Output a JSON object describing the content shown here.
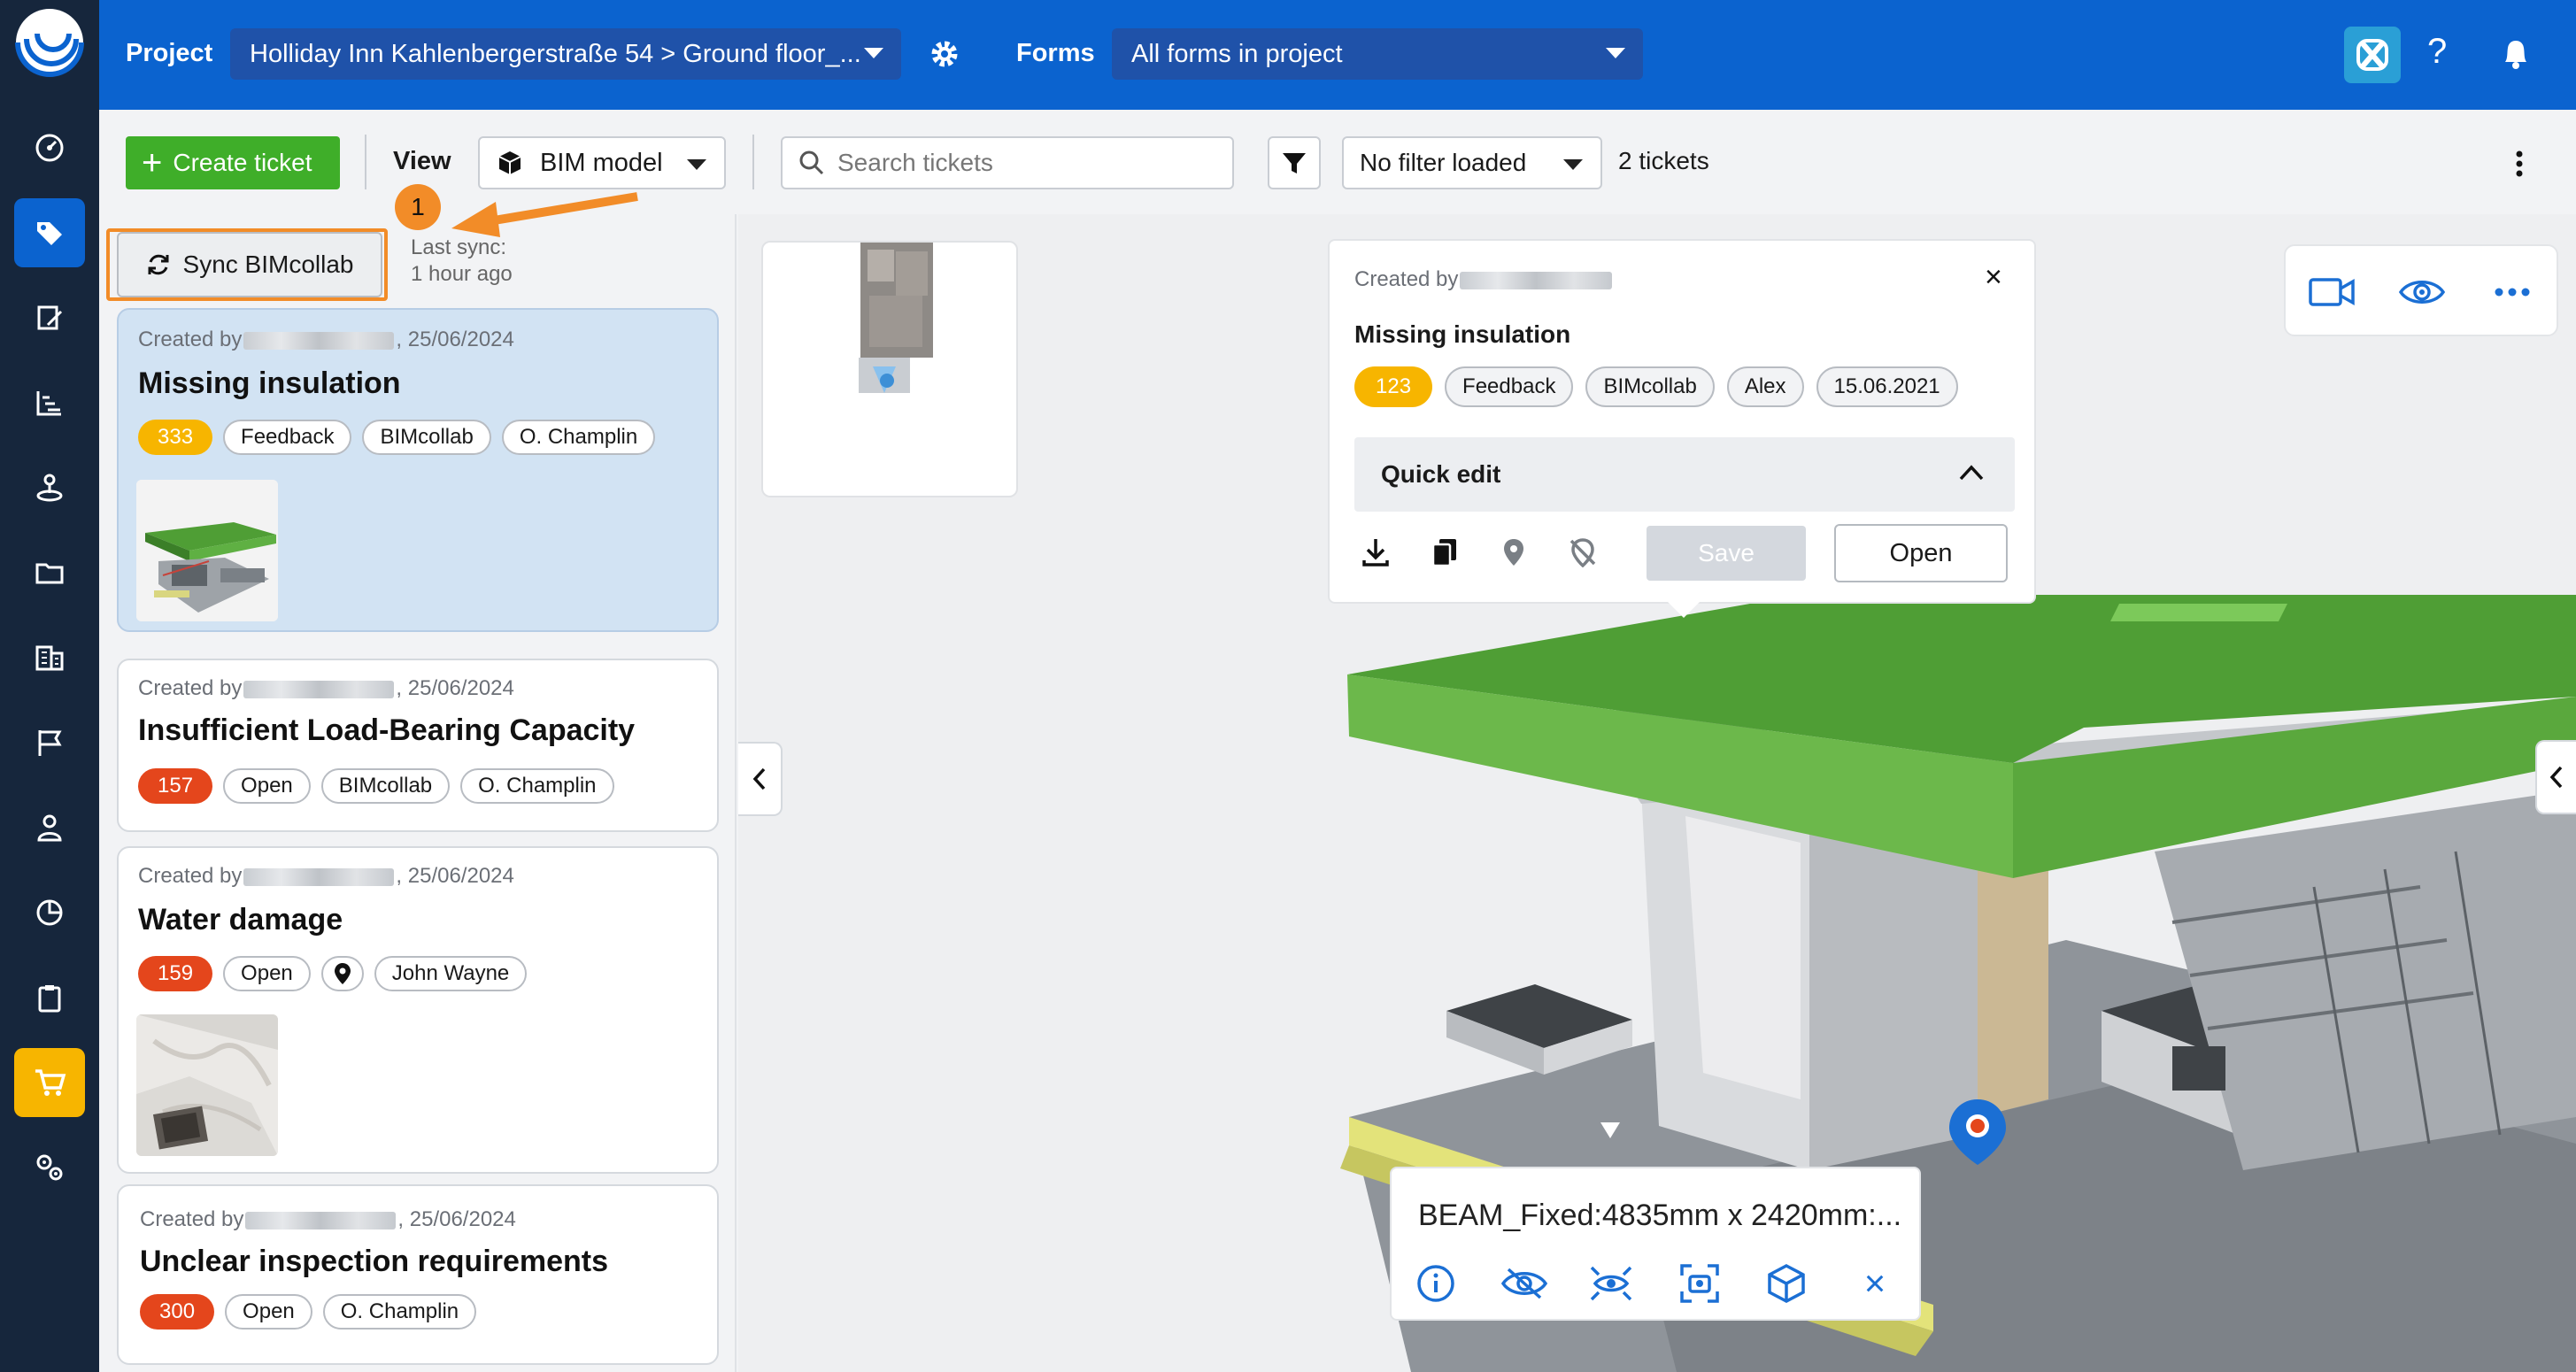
{
  "topbar": {
    "project_label": "Project",
    "project_value": "Holliday Inn Kahlenbergerstraße 54 > Ground floor_...",
    "forms_label": "Forms",
    "forms_value": "All forms in project"
  },
  "toolbar": {
    "create_ticket": "Create ticket",
    "view_label": "View",
    "view_value": "BIM model",
    "search_placeholder": "Search tickets",
    "filter_value": "No filter loaded",
    "ticket_count": "2 tickets"
  },
  "sync": {
    "button": "Sync BIMcollab",
    "last_sync_label": "Last sync:",
    "last_sync_value": "1 hour ago",
    "step_badge": "1"
  },
  "tickets": [
    {
      "created_prefix": "Created by",
      "date": ", 25/06/2024",
      "title": "Missing insulation",
      "number": "333",
      "number_color": "#f7b500",
      "chips": [
        "Feedback",
        "BIMcollab",
        "O. Champlin"
      ]
    },
    {
      "created_prefix": "Created by",
      "date": ", 25/06/2024",
      "title": "Insufficient Load-Bearing Capacity",
      "number": "157",
      "number_color": "#e4461c",
      "chips": [
        "Open",
        "BIMcollab",
        "O. Champlin"
      ]
    },
    {
      "created_prefix": "Created by",
      "date": ", 25/06/2024",
      "title": "Water damage",
      "number": "159",
      "number_color": "#e4461c",
      "chips": [
        "Open",
        "John Wayne"
      ]
    },
    {
      "created_prefix": "Created by",
      "date": ", 25/06/2024",
      "title": "Unclear inspection requirements",
      "number": "300",
      "number_color": "#e4461c",
      "chips": [
        "Open",
        "O. Champlin"
      ]
    }
  ],
  "popup": {
    "created_prefix": "Created by",
    "title": "Missing insulation",
    "number": "123",
    "number_color": "#f7b500",
    "chips": [
      "Feedback",
      "BIMcollab",
      "Alex",
      "15.06.2021"
    ],
    "quick_edit": "Quick edit",
    "save": "Save",
    "open": "Open"
  },
  "element_popup": {
    "label": "BEAM_Fixed:4835mm x 2420mm:..."
  },
  "colors": {
    "brand": "#0b63cf",
    "sidebar": "#16263c",
    "create": "#3fae29",
    "highlight": "#f28c28",
    "badge_yellow": "#f7b500",
    "badge_red": "#e4461c",
    "roof_green": "#4f9e35"
  }
}
